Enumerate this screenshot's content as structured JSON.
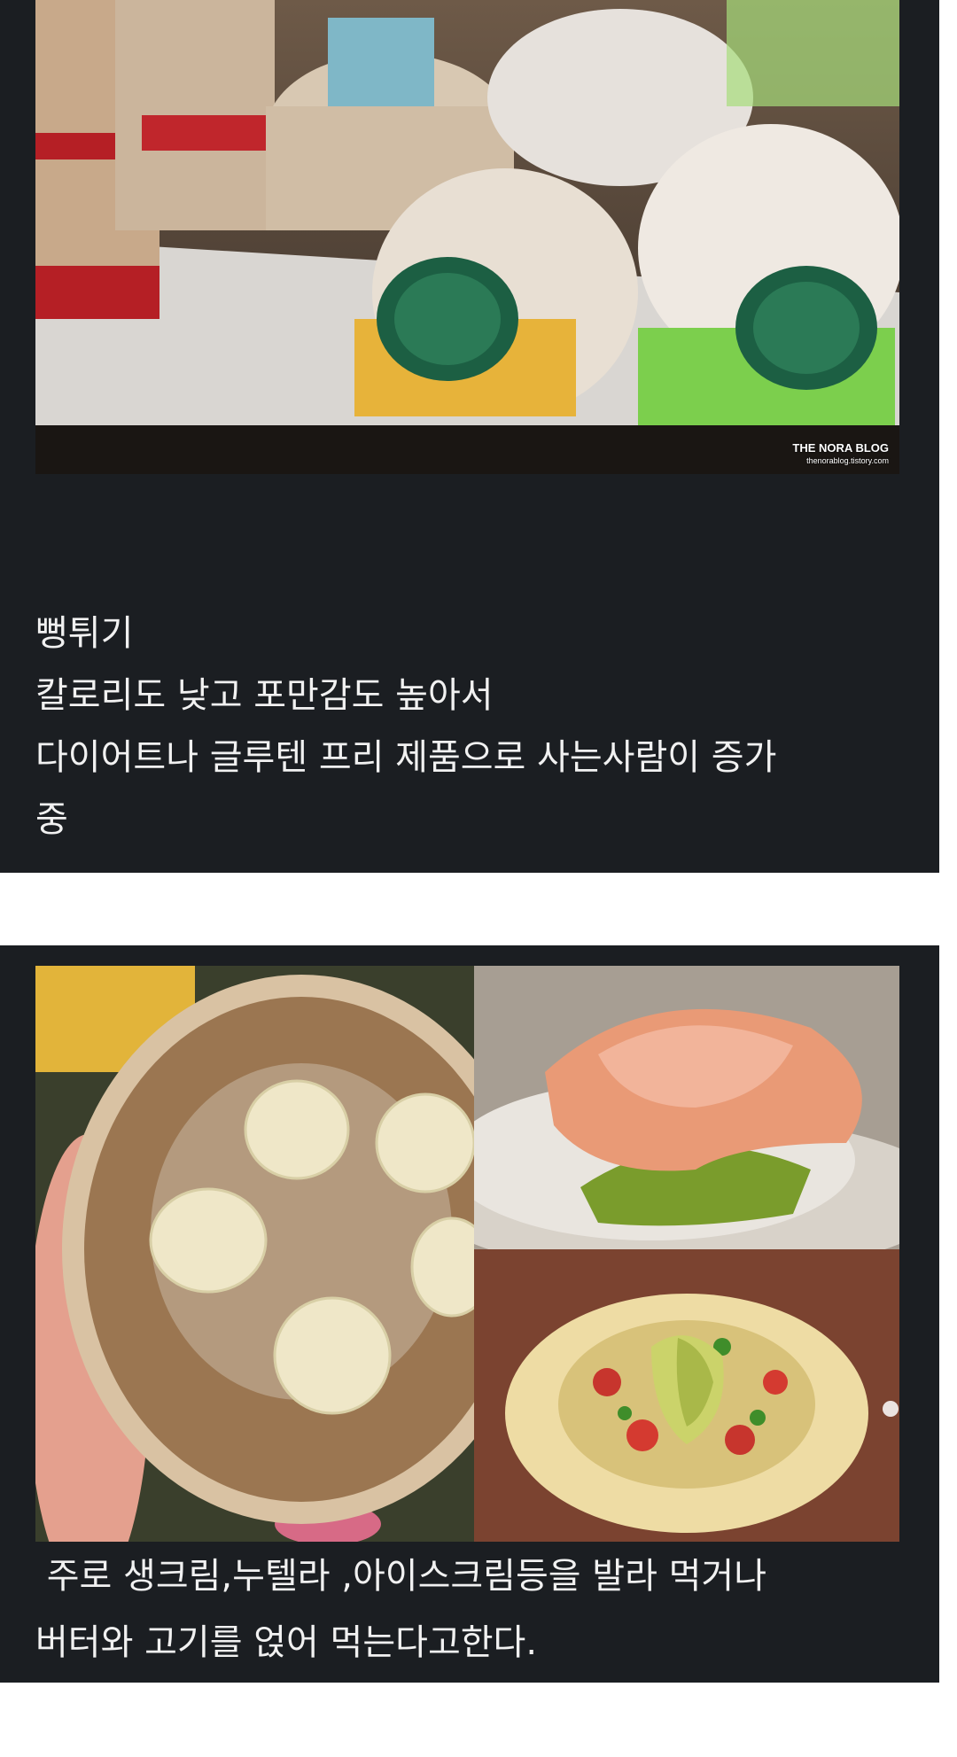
{
  "top_photo": {
    "description_icon": "rice-cake-packages-photo",
    "watermark_line1": "THE NORA BLOG",
    "watermark_line2": "thenorablog.tistory.com"
  },
  "caption1": {
    "line1": "뻥튀기",
    "line2": "칼로리도 낮고 포만감도 높아서",
    "line3": "다이어트나 글루텐 프리 제품으로 사는사람이 증가",
    "line4": "중"
  },
  "bottom_photos": {
    "left_icon": "rice-cake-banana-photo",
    "top_right_icon": "rice-cake-salmon-avocado-photo",
    "bottom_right_icon": "rice-cake-salsa-avocado-photo"
  },
  "caption2": {
    "line1": " 주로 생크림,누텔라 ,아이스크림등을 발라 먹거나",
    "line2": "버터와 고기를 얹어 먹는다고한다."
  }
}
